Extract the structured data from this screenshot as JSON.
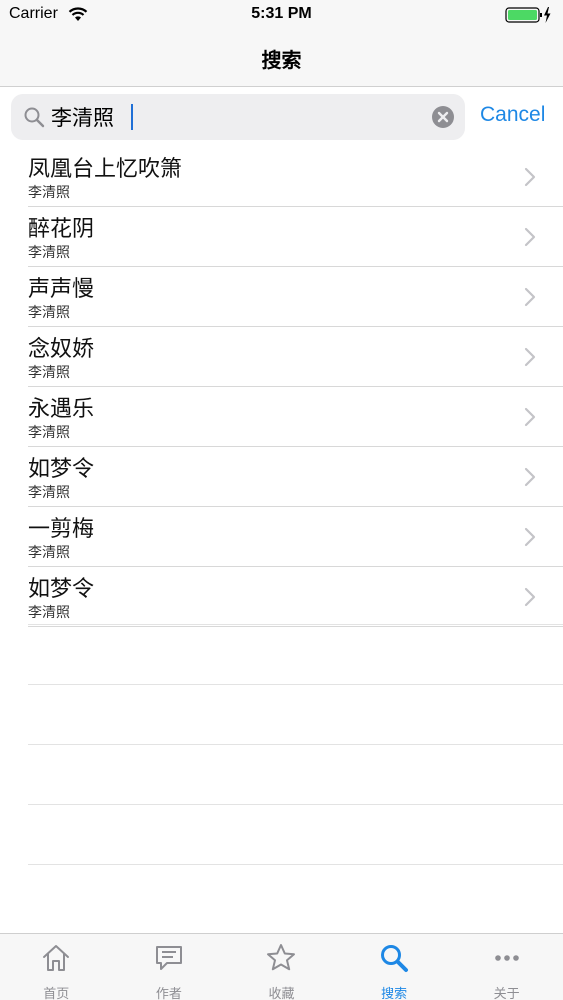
{
  "status_bar": {
    "carrier": "Carrier",
    "time": "5:31 PM",
    "battery_color": "#4cd964"
  },
  "nav": {
    "title": "搜索"
  },
  "search": {
    "value": "李清照",
    "cancel_label": "Cancel",
    "accent_color": "#1e88e5"
  },
  "results": [
    {
      "title": "凤凰台上忆吹箫",
      "author": "李清照"
    },
    {
      "title": "醉花阴",
      "author": "李清照"
    },
    {
      "title": "声声慢",
      "author": "李清照"
    },
    {
      "title": "念奴娇",
      "author": "李清照"
    },
    {
      "title": "永遇乐",
      "author": "李清照"
    },
    {
      "title": "如梦令",
      "author": "李清照"
    },
    {
      "title": "一剪梅",
      "author": "李清照"
    },
    {
      "title": "如梦令",
      "author": "李清照"
    }
  ],
  "tabs": [
    {
      "label": "首页",
      "icon": "home-icon",
      "active": false
    },
    {
      "label": "作者",
      "icon": "chat-icon",
      "active": false
    },
    {
      "label": "收藏",
      "icon": "star-icon",
      "active": false
    },
    {
      "label": "搜索",
      "icon": "search-icon",
      "active": true
    },
    {
      "label": "关于",
      "icon": "more-icon",
      "active": false
    }
  ]
}
